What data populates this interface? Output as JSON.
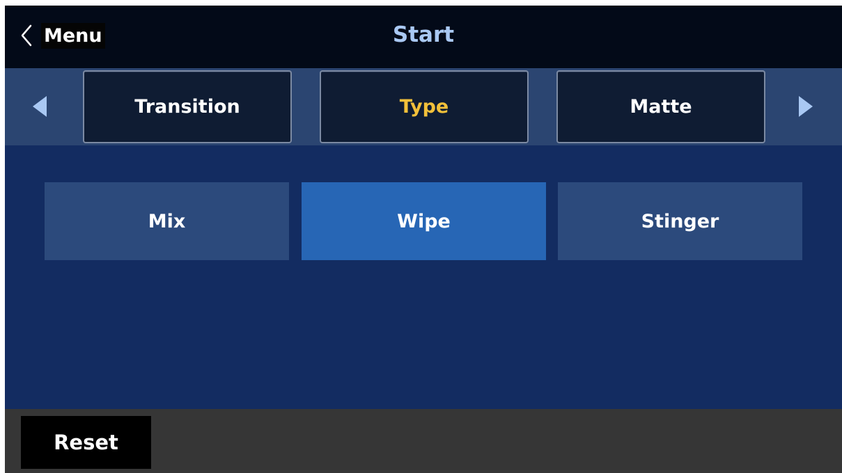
{
  "header": {
    "back_label": "Menu",
    "back_icon": "chevron-left-icon",
    "title": "Start"
  },
  "tabs": {
    "prev_icon": "triangle-left-icon",
    "next_icon": "triangle-right-icon",
    "items": [
      {
        "label": "Transition",
        "active": false
      },
      {
        "label": "Type",
        "active": true
      },
      {
        "label": "Matte",
        "active": false
      }
    ],
    "active_color": "#f2c03a"
  },
  "options": {
    "items": [
      {
        "label": "Mix",
        "selected": false
      },
      {
        "label": "Wipe",
        "selected": true
      },
      {
        "label": "Stinger",
        "selected": false
      }
    ],
    "selected_color": "#2766b5",
    "default_color": "#2c4a7c"
  },
  "footer": {
    "reset_label": "Reset"
  },
  "colors": {
    "title": "#a9c8f3",
    "background": "#132c61",
    "titlebar": "#030a18",
    "tabbar": "#2b4571",
    "footer": "#363636"
  }
}
